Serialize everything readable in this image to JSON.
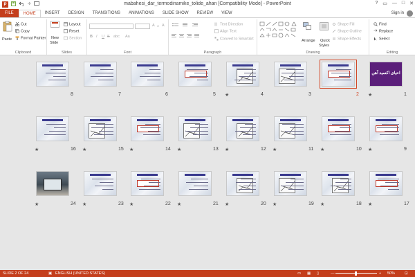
{
  "window": {
    "title": "mabahesi_dar_termodinamike_tolide_ahan [Compatibility Mode] - PowerPoint",
    "app_logo": "P",
    "qat_icons": [
      "save-icon",
      "undo-icon",
      "redo-icon",
      "start-from-beginning-icon"
    ],
    "controls": [
      "?",
      "▭",
      "—",
      "□",
      "✕"
    ]
  },
  "tabs": [
    "FILE",
    "HOME",
    "INSERT",
    "DESIGN",
    "TRANSITIONS",
    "ANIMATIONS",
    "SLIDE SHOW",
    "REVIEW",
    "VIEW"
  ],
  "active_tab": "HOME",
  "signin": "Sign in",
  "ribbon": {
    "clipboard": {
      "paste": "Paste",
      "cut": "Cut",
      "copy": "Copy",
      "format_painter": "Format Painter",
      "label": "Clipboard"
    },
    "slides": {
      "new_slide": "New",
      "new_slide2": "Slide",
      "layout": "Layout",
      "reset": "Reset",
      "section": "Section",
      "label": "Slides"
    },
    "font": {
      "label": "Font",
      "bold": "B",
      "italic": "I",
      "underline": "U",
      "strike": "S",
      "shadow": "abc",
      "aa": "Aa",
      "grow": "A",
      "shrink": "A",
      "clear": "A"
    },
    "paragraph": {
      "label": "Paragraph",
      "text_direction": "Text Direction",
      "align_text": "Align Text",
      "convert_smartart": "Convert to SmartArt"
    },
    "drawing": {
      "label": "Drawing",
      "arrange": "Arrange",
      "quick_styles": "Quick",
      "quick_styles2": "Styles",
      "shape_fill": "Shape Fill",
      "shape_outline": "Shape Outline",
      "shape_effects": "Shape Effects"
    },
    "editing": {
      "label": "Editing",
      "find": "Find",
      "replace": "Replace",
      "select": "Select"
    }
  },
  "slides": [
    {
      "num": "8",
      "star": ""
    },
    {
      "num": "7",
      "star": ""
    },
    {
      "num": "6",
      "star": ""
    },
    {
      "num": "5",
      "star": ""
    },
    {
      "num": "4",
      "star": "★"
    },
    {
      "num": "3",
      "star": ""
    },
    {
      "num": "2",
      "star": ""
    },
    {
      "num": "1",
      "star": "★"
    },
    {
      "num": "16",
      "star": "★"
    },
    {
      "num": "15",
      "star": "★"
    },
    {
      "num": "14",
      "star": "★"
    },
    {
      "num": "13",
      "star": "★"
    },
    {
      "num": "12",
      "star": "★"
    },
    {
      "num": "11",
      "star": "★"
    },
    {
      "num": "10",
      "star": "★"
    },
    {
      "num": "9",
      "star": "★"
    },
    {
      "num": "24",
      "star": "★"
    },
    {
      "num": "23",
      "star": "★"
    },
    {
      "num": "22",
      "star": "★"
    },
    {
      "num": "21",
      "star": "★"
    },
    {
      "num": "20",
      "star": "★"
    },
    {
      "num": "19",
      "star": "★"
    },
    {
      "num": "18",
      "star": "★"
    },
    {
      "num": "17",
      "star": "★"
    }
  ],
  "slide1_title": "احیای اکسید آهن",
  "selected_slide": "2",
  "status": {
    "slide": "SLIDE 2 OF 24",
    "language": "ENGLISH (UNITED STATES)",
    "zoom": "50%",
    "zoom_minus": "—",
    "zoom_plus": "+"
  },
  "colors": {
    "accent": "#c43e1c",
    "selection": "#d24726",
    "slide_title_bar": "#3b3b8f",
    "slide1_bg": "#5b1f7a"
  }
}
